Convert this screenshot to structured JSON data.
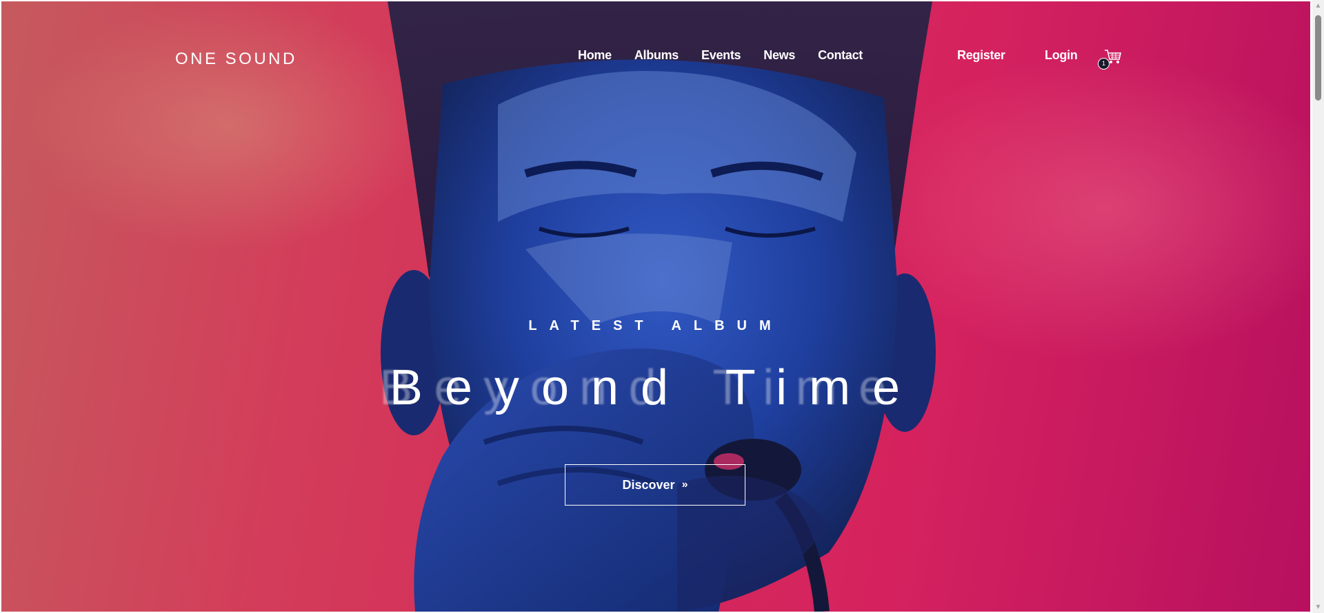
{
  "brand": {
    "logo": "ONE SOUND"
  },
  "nav": {
    "items": [
      "Home",
      "Albums",
      "Events",
      "News",
      "Contact"
    ],
    "register": "Register",
    "login": "Login",
    "cart_count": "1"
  },
  "hero": {
    "eyebrow": "LATEST ALBUM",
    "title": "Beyond Time",
    "cta_label": "Discover",
    "cta_icon": "double-chevron-right-icon"
  },
  "colors": {
    "hero_left": "#c55a5e",
    "hero_mid": "#d42a5a",
    "hero_right": "#b7105f",
    "figure_blue": "#1b3f9c",
    "text": "#ffffff"
  }
}
